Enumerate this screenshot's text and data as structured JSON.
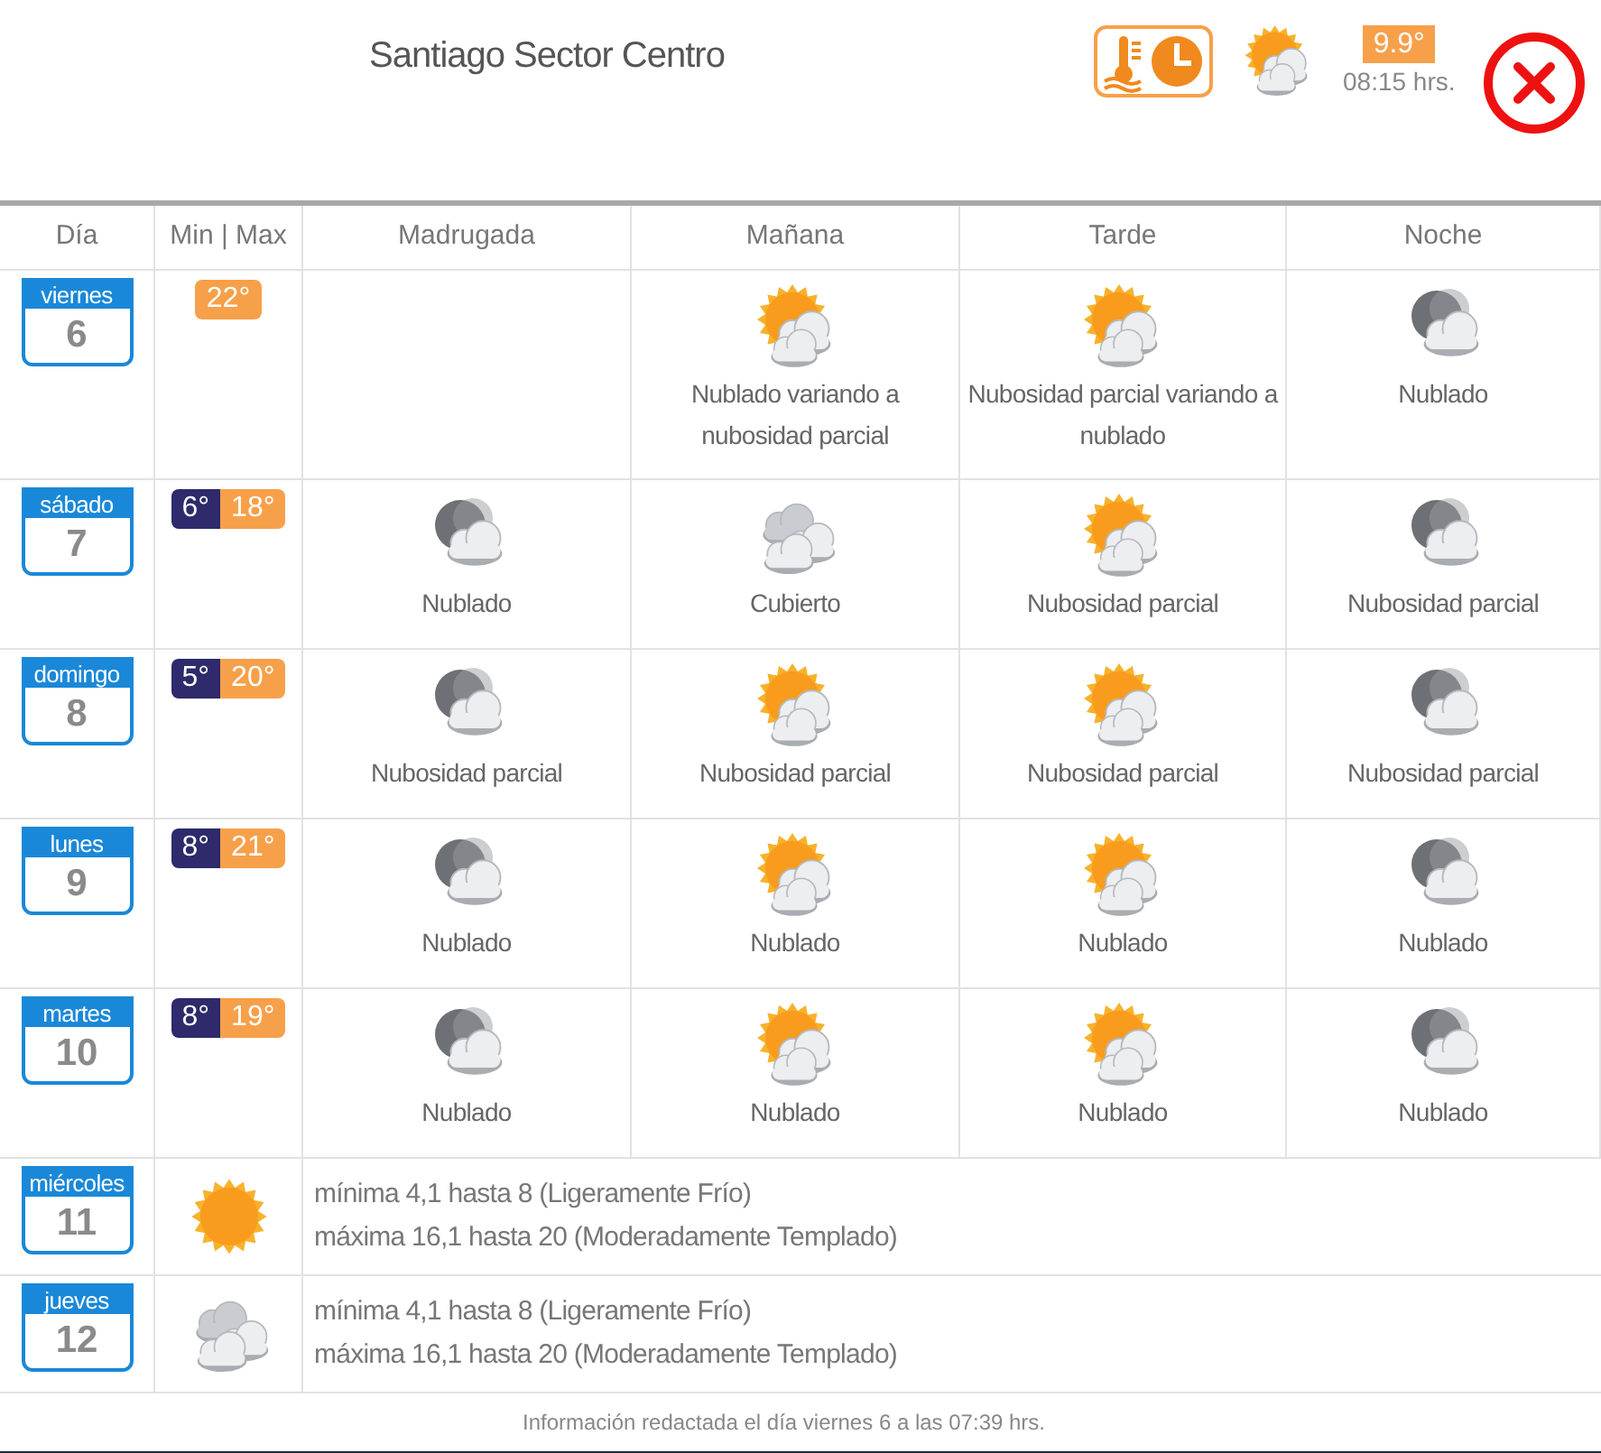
{
  "header": {
    "title": "Santiago Sector Centro",
    "current": {
      "kind": "sun_cloud",
      "temperature": "9.9°",
      "time": "08:15 hrs."
    }
  },
  "columns": [
    "Día",
    "Min | Max",
    "Madrugada",
    "Mañana",
    "Tarde",
    "Noche"
  ],
  "days": [
    {
      "kind": "detailed",
      "weekday": "viernes",
      "day": "6",
      "max": "22°",
      "periods": [
        {
          "kind": "sun_cloud",
          "label": "Nublado variando a nubosidad parcial"
        },
        {
          "kind": "sun_cloud",
          "label": "Nubosidad parcial variando a nublado"
        },
        {
          "kind": "moon_cloud",
          "label": "Nublado"
        }
      ]
    },
    {
      "kind": "detailed",
      "weekday": "sábado",
      "day": "7",
      "min": "6°",
      "max": "18°",
      "periods": [
        {
          "kind": "moon_cloud",
          "label": "Nublado"
        },
        {
          "kind": "clouds",
          "label": "Cubierto"
        },
        {
          "kind": "sun_cloud",
          "label": "Nubosidad parcial"
        },
        {
          "kind": "moon_cloud",
          "label": "Nubosidad parcial"
        }
      ]
    },
    {
      "kind": "detailed",
      "weekday": "domingo",
      "day": "8",
      "min": "5°",
      "max": "20°",
      "periods": [
        {
          "kind": "moon_cloud",
          "label": "Nubosidad parcial"
        },
        {
          "kind": "sun_cloud",
          "label": "Nubosidad parcial"
        },
        {
          "kind": "sun_cloud",
          "label": "Nubosidad parcial"
        },
        {
          "kind": "moon_cloud",
          "label": "Nubosidad parcial"
        }
      ]
    },
    {
      "kind": "detailed",
      "weekday": "lunes",
      "day": "9",
      "min": "8°",
      "max": "21°",
      "periods": [
        {
          "kind": "moon_cloud",
          "label": "Nublado"
        },
        {
          "kind": "sun_cloud",
          "label": "Nublado"
        },
        {
          "kind": "sun_cloud",
          "label": "Nublado"
        },
        {
          "kind": "moon_cloud",
          "label": "Nublado"
        }
      ]
    },
    {
      "kind": "detailed",
      "weekday": "martes",
      "day": "10",
      "min": "8°",
      "max": "19°",
      "periods": [
        {
          "kind": "moon_cloud",
          "label": "Nublado"
        },
        {
          "kind": "sun_cloud",
          "label": "Nublado"
        },
        {
          "kind": "sun_cloud",
          "label": "Nublado"
        },
        {
          "kind": "moon_cloud",
          "label": "Nublado"
        }
      ]
    },
    {
      "kind": "summary",
      "weekday": "miércoles",
      "day": "11",
      "sky": {
        "kind": "sun"
      },
      "lines": [
        "mínima 4,1 hasta 8 (Ligeramente Frío)",
        "máxima 16,1 hasta 20 (Moderadamente Templado)"
      ]
    },
    {
      "kind": "summary",
      "weekday": "jueves",
      "day": "12",
      "sky": {
        "kind": "clouds"
      },
      "lines": [
        "mínima 4,1 hasta 8 (Ligeramente Frío)",
        "máxima 16,1 hasta 20 (Moderadamente Templado)"
      ]
    }
  ],
  "footer": "Información redactada el día viernes 6 a las 07:39 hrs."
}
